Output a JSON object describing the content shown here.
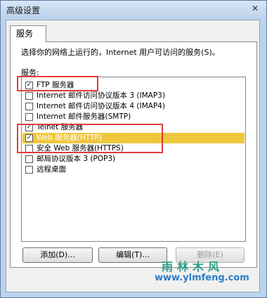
{
  "window": {
    "title": "高级设置",
    "close_glyph": "✕"
  },
  "tab": {
    "label": "服务"
  },
  "intro_text": "选择你的网络上运行的，Internet 用户可访问的服务(S)。",
  "list_label": "服务:",
  "services": [
    {
      "label": "FTP 服务器",
      "checked": true
    },
    {
      "label": "Internet 邮件访问协议版本 3 (IMAP3)",
      "checked": false
    },
    {
      "label": "Internet 邮件访问协议版本 4 (IMAP4)",
      "checked": false
    },
    {
      "label": "Internet 邮件服务器(SMTP)",
      "checked": false
    },
    {
      "label": "Telnet 服务器",
      "checked": true
    },
    {
      "label": "Web 服务器(HTTP)",
      "checked": true,
      "selected": true
    },
    {
      "label": "安全 Web 服务器(HTTPS)",
      "checked": false
    },
    {
      "label": "邮局协议版本 3 (POP3)",
      "checked": false
    },
    {
      "label": "远程桌面",
      "checked": false
    }
  ],
  "buttons": {
    "add": "添加(D)...",
    "edit": "编辑(T)...",
    "delete": "删除(E)"
  },
  "watermark": {
    "line1": "雨林木风",
    "line2": "www.ylmfeng.com"
  },
  "colors": {
    "selection": "#efc73d",
    "annotation_box": "#e03c3c"
  }
}
